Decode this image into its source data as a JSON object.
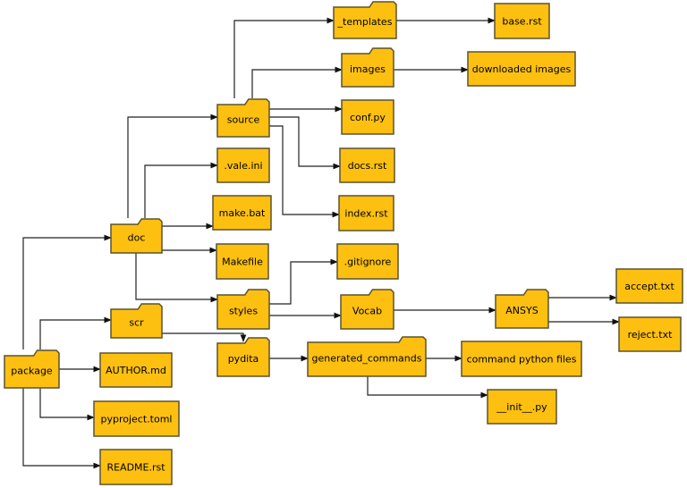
{
  "diagram": {
    "type": "directory-tree",
    "colors": {
      "node_fill": "#FDC010",
      "node_border": "#5a5230",
      "edge": "#222222",
      "background": "#ffffff"
    },
    "nodes": [
      {
        "id": "package",
        "label": "package",
        "kind": "folder"
      },
      {
        "id": "doc",
        "label": "doc",
        "kind": "folder"
      },
      {
        "id": "scr",
        "label": "scr",
        "kind": "folder"
      },
      {
        "id": "author",
        "label": "AUTHOR.md",
        "kind": "file"
      },
      {
        "id": "pyproject",
        "label": "pyproject.toml",
        "kind": "file"
      },
      {
        "id": "readme",
        "label": "README.rst",
        "kind": "file"
      },
      {
        "id": "source",
        "label": "source",
        "kind": "folder"
      },
      {
        "id": "valeini",
        "label": ".vale.ini",
        "kind": "file"
      },
      {
        "id": "makebat",
        "label": "make.bat",
        "kind": "file"
      },
      {
        "id": "makefile",
        "label": "Makefile",
        "kind": "file"
      },
      {
        "id": "styles",
        "label": "styles",
        "kind": "folder"
      },
      {
        "id": "pydita",
        "label": "pydita",
        "kind": "folder"
      },
      {
        "id": "templates",
        "label": "_templates",
        "kind": "folder"
      },
      {
        "id": "images",
        "label": "images",
        "kind": "folder"
      },
      {
        "id": "confpy",
        "label": "conf.py",
        "kind": "file"
      },
      {
        "id": "docsrst",
        "label": "docs.rst",
        "kind": "file"
      },
      {
        "id": "indexrst",
        "label": "index.rst",
        "kind": "file"
      },
      {
        "id": "gitignore",
        "label": ".gitignore",
        "kind": "file"
      },
      {
        "id": "vocab",
        "label": "Vocab",
        "kind": "folder"
      },
      {
        "id": "gencmds",
        "label": "generated_commands",
        "kind": "folder"
      },
      {
        "id": "baserst",
        "label": "base.rst",
        "kind": "file"
      },
      {
        "id": "dlimages",
        "label": "downloaded images",
        "kind": "file"
      },
      {
        "id": "ansys",
        "label": "ANSYS",
        "kind": "folder"
      },
      {
        "id": "cmdpyfiles",
        "label": "command python files",
        "kind": "file"
      },
      {
        "id": "initpy",
        "label": "__init__.py",
        "kind": "file"
      },
      {
        "id": "accept",
        "label": "accept.txt",
        "kind": "file"
      },
      {
        "id": "reject",
        "label": "reject.txt",
        "kind": "file"
      }
    ],
    "edges": [
      {
        "from": "package",
        "to": "doc"
      },
      {
        "from": "package",
        "to": "scr"
      },
      {
        "from": "package",
        "to": "author"
      },
      {
        "from": "package",
        "to": "pyproject"
      },
      {
        "from": "package",
        "to": "readme"
      },
      {
        "from": "doc",
        "to": "source"
      },
      {
        "from": "doc",
        "to": "valeini"
      },
      {
        "from": "doc",
        "to": "makebat"
      },
      {
        "from": "doc",
        "to": "makefile"
      },
      {
        "from": "doc",
        "to": "styles"
      },
      {
        "from": "scr",
        "to": "pydita"
      },
      {
        "from": "source",
        "to": "templates"
      },
      {
        "from": "source",
        "to": "images"
      },
      {
        "from": "source",
        "to": "confpy"
      },
      {
        "from": "source",
        "to": "docsrst"
      },
      {
        "from": "source",
        "to": "indexrst"
      },
      {
        "from": "templates",
        "to": "baserst"
      },
      {
        "from": "images",
        "to": "dlimages"
      },
      {
        "from": "styles",
        "to": "gitignore"
      },
      {
        "from": "styles",
        "to": "vocab"
      },
      {
        "from": "vocab",
        "to": "ansys"
      },
      {
        "from": "ansys",
        "to": "accept"
      },
      {
        "from": "ansys",
        "to": "reject"
      },
      {
        "from": "pydita",
        "to": "gencmds"
      },
      {
        "from": "gencmds",
        "to": "cmdpyfiles"
      },
      {
        "from": "gencmds",
        "to": "initpy"
      }
    ]
  }
}
